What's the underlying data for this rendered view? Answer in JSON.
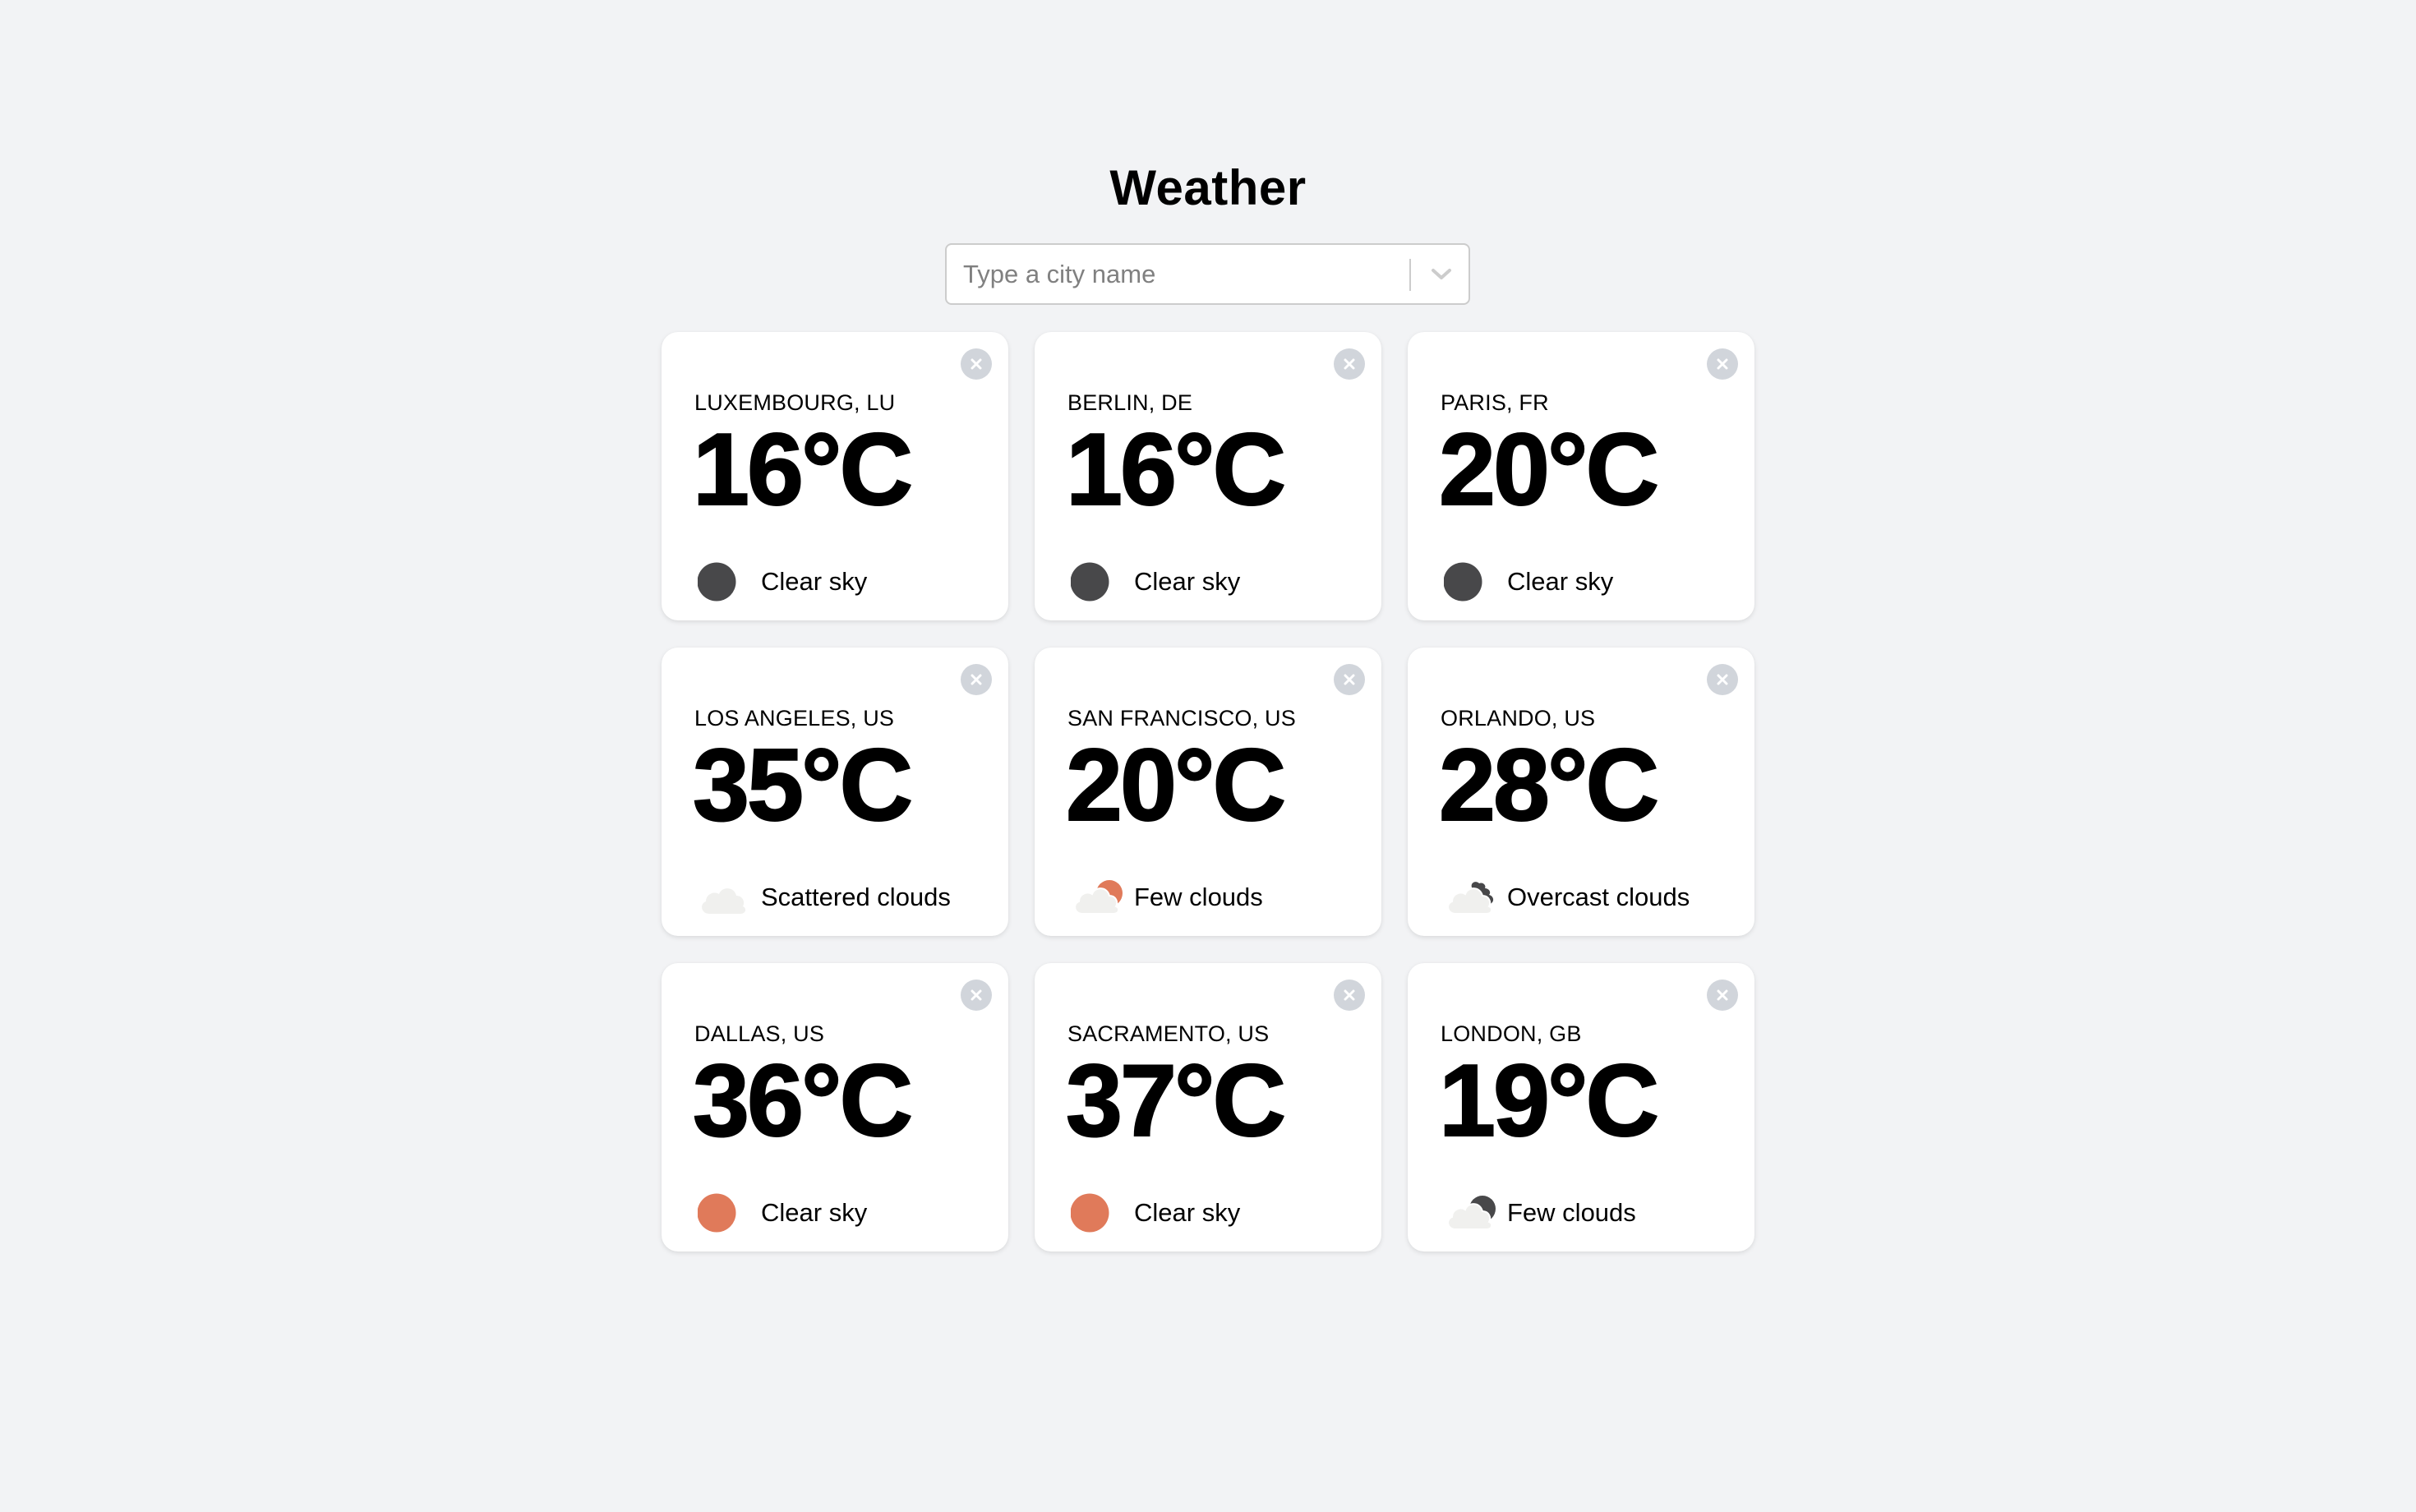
{
  "app": {
    "title": "Weather"
  },
  "search": {
    "placeholder": "Type a city name",
    "value": "",
    "dropdown_icon": "chevron-down-icon"
  },
  "colors": {
    "background": "#f2f3f5",
    "card": "#ffffff",
    "close_button": "#d1d5db",
    "night_icon": "#48484a",
    "day_icon": "#e07a5a",
    "cloud": "#f0f0ee"
  },
  "cards": [
    {
      "city": "LUXEMBOURG, LU",
      "temperature": "16°C",
      "condition": "Clear sky",
      "icon": "clear-night-icon"
    },
    {
      "city": "BERLIN, DE",
      "temperature": "16°C",
      "condition": "Clear sky",
      "icon": "clear-night-icon"
    },
    {
      "city": "PARIS, FR",
      "temperature": "20°C",
      "condition": "Clear sky",
      "icon": "clear-night-icon"
    },
    {
      "city": "LOS ANGELES, US",
      "temperature": "35°C",
      "condition": "Scattered clouds",
      "icon": "cloud-icon"
    },
    {
      "city": "SAN FRANCISCO, US",
      "temperature": "20°C",
      "condition": "Few clouds",
      "icon": "few-clouds-day-icon"
    },
    {
      "city": "ORLANDO, US",
      "temperature": "28°C",
      "condition": "Overcast clouds",
      "icon": "overcast-clouds-icon"
    },
    {
      "city": "DALLAS, US",
      "temperature": "36°C",
      "condition": "Clear sky",
      "icon": "clear-day-icon"
    },
    {
      "city": "SACRAMENTO, US",
      "temperature": "37°C",
      "condition": "Clear sky",
      "icon": "clear-day-icon"
    },
    {
      "city": "LONDON, GB",
      "temperature": "19°C",
      "condition": "Few clouds",
      "icon": "few-clouds-night-icon"
    }
  ]
}
